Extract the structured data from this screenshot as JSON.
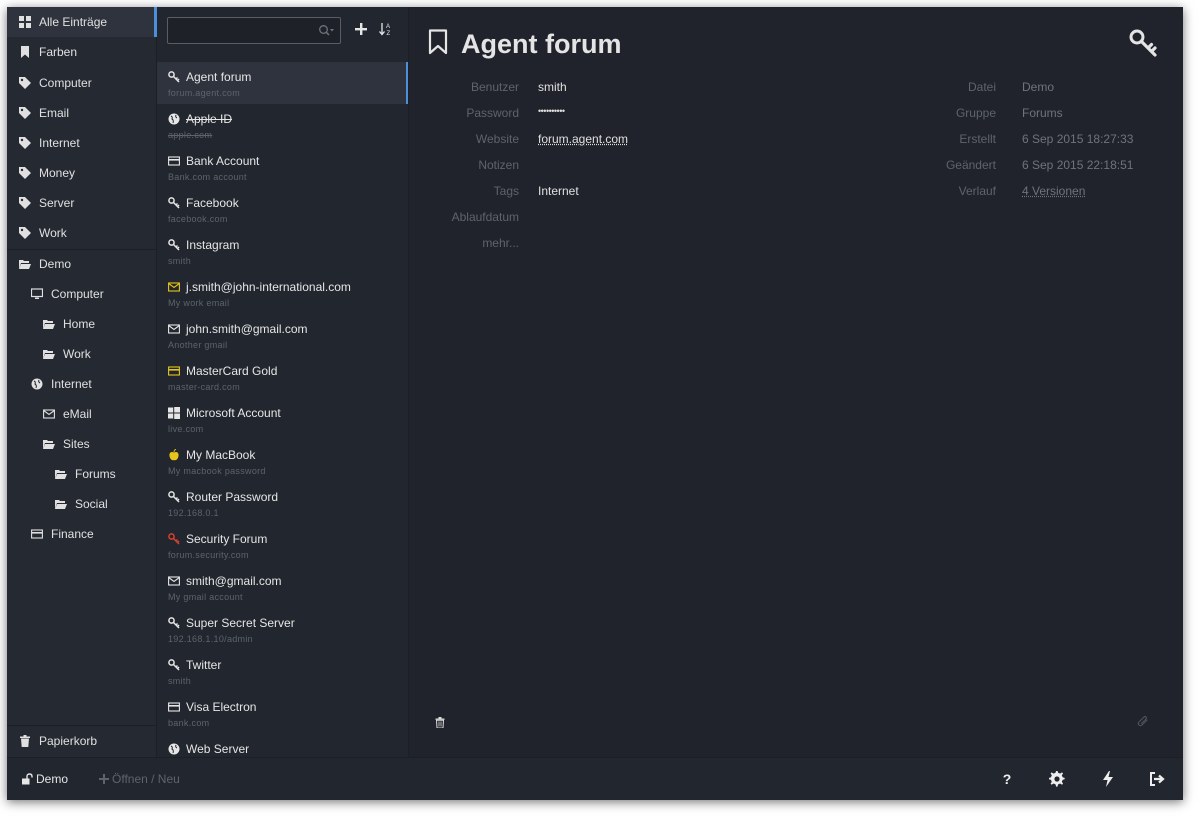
{
  "sidebar": {
    "all_entries": "Alle Einträge",
    "colors": "Farben",
    "tags": [
      "Computer",
      "Email",
      "Internet",
      "Money",
      "Server",
      "Work"
    ],
    "groups": {
      "demo": "Demo",
      "computer": "Computer",
      "home": "Home",
      "work": "Work",
      "internet": "Internet",
      "email": "eMail",
      "sites": "Sites",
      "forums": "Forums",
      "social": "Social",
      "finance": "Finance"
    },
    "trash": "Papierkorb"
  },
  "list": {
    "search_value": "",
    "entries": [
      {
        "title": "Agent forum",
        "sub": "forum.agent.com",
        "icon": "key-icon"
      },
      {
        "title": "Apple ID",
        "sub": "apple.com",
        "icon": "globe-icon"
      },
      {
        "title": "Bank Account",
        "sub": "Bank.com account",
        "icon": "credit-card-icon"
      },
      {
        "title": "Facebook",
        "sub": "facebook.com",
        "icon": "key-icon"
      },
      {
        "title": "Instagram",
        "sub": "smith",
        "icon": "key-icon"
      },
      {
        "title": "j.smith@john-international.com",
        "sub": "My work email",
        "icon": "envelope-icon"
      },
      {
        "title": "john.smith@gmail.com",
        "sub": "Another gmail",
        "icon": "envelope-icon"
      },
      {
        "title": "MasterCard Gold",
        "sub": "master-card.com",
        "icon": "credit-card-icon"
      },
      {
        "title": "Microsoft Account",
        "sub": "live.com",
        "icon": "windows-icon"
      },
      {
        "title": "My MacBook",
        "sub": "My macbook password",
        "icon": "apple-icon"
      },
      {
        "title": "Router Password",
        "sub": "192.168.0.1",
        "icon": "key-icon"
      },
      {
        "title": "Security Forum",
        "sub": "forum.security.com",
        "icon": "key-icon"
      },
      {
        "title": "smith@gmail.com",
        "sub": "My gmail account",
        "icon": "envelope-icon"
      },
      {
        "title": "Super Secret Server",
        "sub": "192.168.1.10/admin",
        "icon": "key-icon"
      },
      {
        "title": "Twitter",
        "sub": "smith",
        "icon": "key-icon"
      },
      {
        "title": "Visa Electron",
        "sub": "bank.com",
        "icon": "credit-card-icon"
      },
      {
        "title": "Web Server",
        "sub": "",
        "icon": "globe-icon"
      }
    ]
  },
  "details": {
    "title": "Agent forum",
    "fields": {
      "user_label": "Benutzer",
      "user_value": "smith",
      "password_label": "Password",
      "password_value": "••••••••••",
      "website_label": "Website",
      "website_value": "forum.agent.com",
      "notes_label": "Notizen",
      "tags_label": "Tags",
      "tags_value": "Internet",
      "expiry_label": "Ablaufdatum",
      "more_label": "mehr..."
    },
    "meta": {
      "file_label": "Datei",
      "file_value": "Demo",
      "group_label": "Gruppe",
      "group_value": "Forums",
      "created_label": "Erstellt",
      "created_value": "6 Sep 2015 18:27:33",
      "modified_label": "Geändert",
      "modified_value": "6 Sep 2015 22:18:51",
      "history_label": "Verlauf",
      "history_value": "4 Versionen"
    }
  },
  "footer": {
    "file": "Demo",
    "open_new": "Öffnen / Neu",
    "help": "?"
  },
  "colors": {
    "accent": "#4e8fdc",
    "red_key": "#d9412b",
    "yellow": "#e8c51a"
  }
}
